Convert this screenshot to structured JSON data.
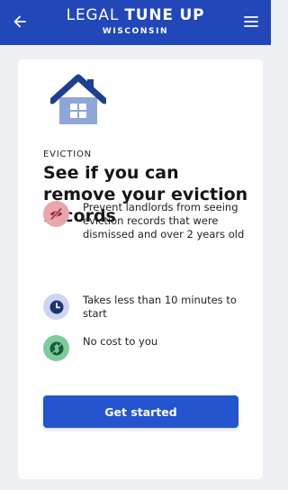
{
  "header": {
    "title_light": "LEGAL ",
    "title_bold": "TUNE UP",
    "subtitle": "WISCONSIN",
    "back_icon": "arrow-left-icon",
    "menu_icon": "hamburger-menu-icon"
  },
  "card": {
    "illustration_icon": "house-icon",
    "eyebrow": "EVICTION",
    "headline": "See if you can remove your eviction records",
    "features": [
      {
        "icon": "eye-off-icon",
        "text": "Prevent landlords from seeing eviction records that were dismissed and over 2 years old"
      },
      {
        "icon": "clock-icon",
        "text": "Takes less than 10 minutes to start"
      },
      {
        "icon": "no-dollar-icon",
        "text": "No cost to you"
      }
    ],
    "cta_label": "Get started"
  },
  "colors": {
    "brand_blue": "#2147b8",
    "button_blue": "#2455cf",
    "house_roof": "#1e3f8f",
    "house_wall": "#8ea6d8",
    "eye_bg": "#e7a7ad",
    "clock_bg": "#cdd6f0",
    "dollar_bg": "#7ecb9c"
  }
}
